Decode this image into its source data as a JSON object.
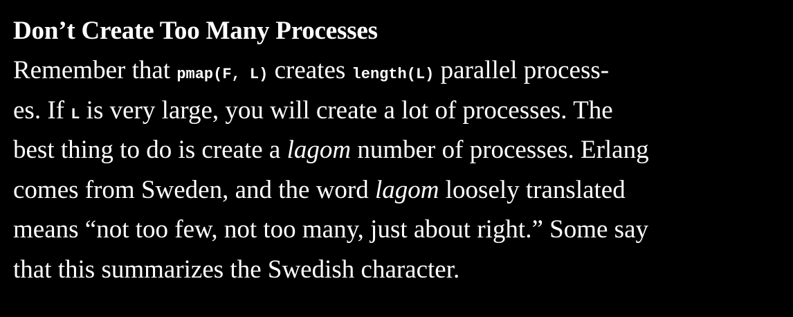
{
  "title": "Don’t Create Too Many Processes",
  "lines": [
    {
      "t1": "Remember that ",
      "c1": "pmap(F, L)",
      "t2": " creates ",
      "c2": "length(L)",
      "t3": " parallel process-"
    },
    {
      "t1": "es. If ",
      "c1": "L",
      "t2": " is very large, you will create a lot of processes. The"
    },
    {
      "t1": "best thing to do is create a ",
      "e1": "lagom",
      "t2": " number of processes. Erlang"
    },
    {
      "t1": "comes from Sweden, and the word ",
      "e1": "lagom",
      "t2": " loosely translated"
    },
    {
      "t1": "means “not too few, not too many, just about right.” Some say"
    },
    {
      "t1": "that this summarizes the Swedish character."
    }
  ]
}
